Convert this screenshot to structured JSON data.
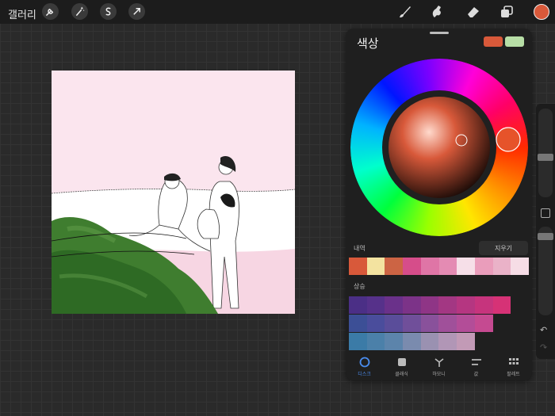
{
  "topbar": {
    "gallery_label": "갤러리",
    "action_icons": [
      "wrench-icon",
      "magic-wand-icon",
      "selection-icon",
      "transform-arrow-icon"
    ],
    "tool_icons": [
      "brush-icon",
      "smudge-icon",
      "eraser-icon",
      "layers-icon"
    ],
    "current_color": "#d8593a"
  },
  "panel": {
    "title": "색상",
    "primary_swatch": "#d8593a",
    "secondary_swatch": "#b7dea6",
    "history_label": "내역",
    "clear_label": "지우기",
    "history_colors": [
      "#d8593a",
      "#f3e3a0",
      "#cc6444",
      "#d64d8a",
      "#df75a6",
      "#e48bb3",
      "#f6dfe8",
      "#ea9dbb",
      "#eab2c8",
      "#f6dde6"
    ],
    "palette_label": "상승",
    "palette_rows": [
      [
        "#4b2f86",
        "#56318a",
        "#6a318a",
        "#7c3388",
        "#8f3586",
        "#a33783",
        "#b53681",
        "#c6347d",
        "#d63276"
      ],
      [
        "#3c4f96",
        "#4a4d9c",
        "#5a4d9a",
        "#704f9a",
        "#89519b",
        "#a0509a",
        "#b34d98",
        "#c54a91"
      ],
      [
        "#3b7ba7",
        "#4b80a9",
        "#5c84ab",
        "#7a8bae",
        "#9a91b1",
        "#b196b6",
        "#c29ab6"
      ]
    ],
    "tabs": [
      {
        "label": "디스크",
        "icon": "disc-icon",
        "active": true
      },
      {
        "label": "클래식",
        "icon": "classic-square-icon",
        "active": false
      },
      {
        "label": "하모니",
        "icon": "harmony-icon",
        "active": false
      },
      {
        "label": "값",
        "icon": "value-sliders-icon",
        "active": false
      },
      {
        "label": "팔레트",
        "icon": "palette-grid-icon",
        "active": false
      }
    ]
  },
  "sidebar": {
    "controls": [
      "brush-size-slider",
      "modify-button",
      "opacity-slider",
      "undo-icon",
      "redo-icon"
    ]
  },
  "canvas": {
    "background": "#fbe5ee"
  }
}
